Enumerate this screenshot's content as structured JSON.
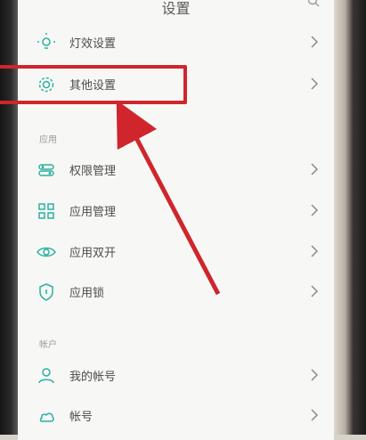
{
  "header": {
    "title": "设置"
  },
  "items": [
    {
      "label": "灯效设置"
    },
    {
      "label": "其他设置"
    },
    {
      "label": "权限管理"
    },
    {
      "label": "应用管理"
    },
    {
      "label": "应用双开"
    },
    {
      "label": "应用锁"
    },
    {
      "label": "我的帐号"
    },
    {
      "label": "帐号"
    }
  ],
  "sections": {
    "apps": "应用",
    "account": "帐户"
  },
  "colors": {
    "accent": "#2bb0a0",
    "highlight": "#d0252c"
  },
  "icons": [
    "search-icon",
    "bulb-icon",
    "gear-icon",
    "toggle-icon",
    "grid-icon",
    "eye-icon",
    "shield-icon",
    "person-icon",
    "cloud-icon",
    "chevron-right-icon"
  ]
}
